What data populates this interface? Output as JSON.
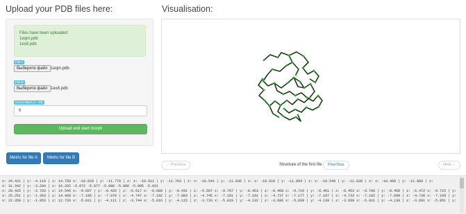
{
  "upload": {
    "title": "Upload your PDB files here:",
    "alert_lines": [
      "Files have been uploaded:",
      "1eqm.pdb",
      "1ex8.pdb"
    ],
    "file_a": {
      "label": "File A",
      "button": "Выберите файл",
      "filename": "1eqm.pdb"
    },
    "file_b": {
      "label": "File B",
      "button": "Выберите файл",
      "filename": "1ex8.pdb"
    },
    "steps": {
      "label": "Count steps (1 - 50)",
      "value": "6"
    },
    "upload_button": "Upload and start morph"
  },
  "metrics": {
    "file_a": "Metric for file A",
    "file_b": "Metric for file B"
  },
  "visualisation": {
    "title": "Visualisation:",
    "previous": "← Previous",
    "structure_label": "Structure of the first file",
    "play_stop": "Play/Stop",
    "next": "Next →",
    "colors": {
      "bond": "#1a3a18",
      "atom": "#2fa62f"
    }
  },
  "log": {
    "lines": [
      "x: 34.421 | y: -4.119 | z: 14.758      x: -10.629 | y: -11.770 | z:          x: -10.611 | y: -11.783 | z:          x: -10.541 | y: -11.836 | z:          x: -10.516 | y: -11.854 | z:          x: -10.549 | y: -11.830 | z:          x: -10.468 | y: -11.889 | z:",
      "x: 31.342 | y: -3.284 | z: 16.262                    -5.872                               -5.877                               -5.898                               -5.906                               -5.895                               -5.921",
      "x: 28.425 | y: -2.793 | z: 14.546    x: -9.697 | y: -8.426 | z: -6.517   x: -9.699 | y: -8.431 | z: -6.507   x: -9.707 | y: -8.453 | z: -6.468   x: -9.710 | y: -8.461 | z: -6.453   x: -9.706 | y: -8.450 | z: -6.472   x: -9.715 | y: -8.476 | z: -6.425",
      "x: 25.251 | y: -1.363 | z: 14.468    x: -7.195 | y: -7.079 | z: -4.747   x: -7.192 | y: -7.083 | z: -4.745   x: -7.181 | y: -7.101 | z: -4.737   x: -7.177 | y: -7.107 | z: -4.733   x: -7.182 | y: -7.099 | z: -4.736   x: -7.169 | y: -7.119 | z: -4.727",
      "x: 22.358 | y: -1.853 | z: 12.726    x: -5.811 | y: -4.111 | z: -3.744   x: -5.816 | y: -4.115 | z: -3.733   x: -5.833 | y: -4.132 | z: -3.686   x: -5.839 | y: -4.139 | z: -3.669   x: -5.831 | y: -4.130 | z: -3.691   x: -5.851 | y: -4.152 | z: -3.636"
    ]
  }
}
